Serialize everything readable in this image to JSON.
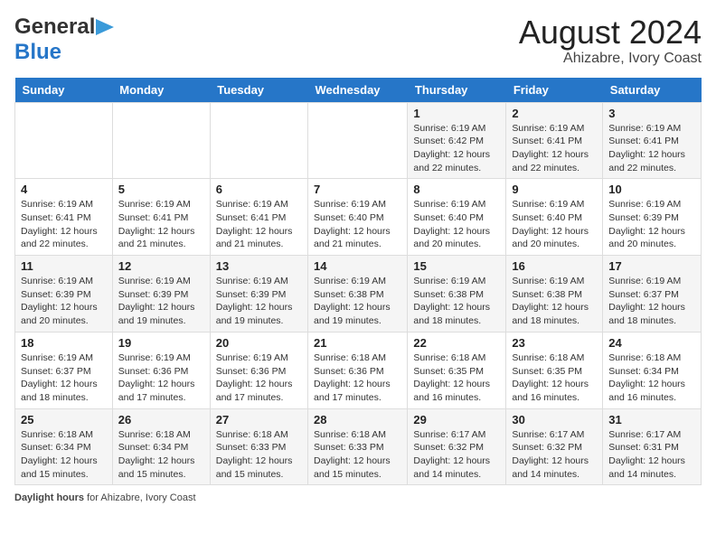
{
  "logo": {
    "line1": "General",
    "line2": "Blue"
  },
  "title": {
    "month_year": "August 2024",
    "location": "Ahizabre, Ivory Coast"
  },
  "days_of_week": [
    "Sunday",
    "Monday",
    "Tuesday",
    "Wednesday",
    "Thursday",
    "Friday",
    "Saturday"
  ],
  "weeks": [
    [
      {
        "day": "",
        "detail": ""
      },
      {
        "day": "",
        "detail": ""
      },
      {
        "day": "",
        "detail": ""
      },
      {
        "day": "",
        "detail": ""
      },
      {
        "day": "1",
        "detail": "Sunrise: 6:19 AM\nSunset: 6:42 PM\nDaylight: 12 hours\nand 22 minutes."
      },
      {
        "day": "2",
        "detail": "Sunrise: 6:19 AM\nSunset: 6:41 PM\nDaylight: 12 hours\nand 22 minutes."
      },
      {
        "day": "3",
        "detail": "Sunrise: 6:19 AM\nSunset: 6:41 PM\nDaylight: 12 hours\nand 22 minutes."
      }
    ],
    [
      {
        "day": "4",
        "detail": "Sunrise: 6:19 AM\nSunset: 6:41 PM\nDaylight: 12 hours\nand 22 minutes."
      },
      {
        "day": "5",
        "detail": "Sunrise: 6:19 AM\nSunset: 6:41 PM\nDaylight: 12 hours\nand 21 minutes."
      },
      {
        "day": "6",
        "detail": "Sunrise: 6:19 AM\nSunset: 6:41 PM\nDaylight: 12 hours\nand 21 minutes."
      },
      {
        "day": "7",
        "detail": "Sunrise: 6:19 AM\nSunset: 6:40 PM\nDaylight: 12 hours\nand 21 minutes."
      },
      {
        "day": "8",
        "detail": "Sunrise: 6:19 AM\nSunset: 6:40 PM\nDaylight: 12 hours\nand 20 minutes."
      },
      {
        "day": "9",
        "detail": "Sunrise: 6:19 AM\nSunset: 6:40 PM\nDaylight: 12 hours\nand 20 minutes."
      },
      {
        "day": "10",
        "detail": "Sunrise: 6:19 AM\nSunset: 6:39 PM\nDaylight: 12 hours\nand 20 minutes."
      }
    ],
    [
      {
        "day": "11",
        "detail": "Sunrise: 6:19 AM\nSunset: 6:39 PM\nDaylight: 12 hours\nand 20 minutes."
      },
      {
        "day": "12",
        "detail": "Sunrise: 6:19 AM\nSunset: 6:39 PM\nDaylight: 12 hours\nand 19 minutes."
      },
      {
        "day": "13",
        "detail": "Sunrise: 6:19 AM\nSunset: 6:39 PM\nDaylight: 12 hours\nand 19 minutes."
      },
      {
        "day": "14",
        "detail": "Sunrise: 6:19 AM\nSunset: 6:38 PM\nDaylight: 12 hours\nand 19 minutes."
      },
      {
        "day": "15",
        "detail": "Sunrise: 6:19 AM\nSunset: 6:38 PM\nDaylight: 12 hours\nand 18 minutes."
      },
      {
        "day": "16",
        "detail": "Sunrise: 6:19 AM\nSunset: 6:38 PM\nDaylight: 12 hours\nand 18 minutes."
      },
      {
        "day": "17",
        "detail": "Sunrise: 6:19 AM\nSunset: 6:37 PM\nDaylight: 12 hours\nand 18 minutes."
      }
    ],
    [
      {
        "day": "18",
        "detail": "Sunrise: 6:19 AM\nSunset: 6:37 PM\nDaylight: 12 hours\nand 18 minutes."
      },
      {
        "day": "19",
        "detail": "Sunrise: 6:19 AM\nSunset: 6:36 PM\nDaylight: 12 hours\nand 17 minutes."
      },
      {
        "day": "20",
        "detail": "Sunrise: 6:19 AM\nSunset: 6:36 PM\nDaylight: 12 hours\nand 17 minutes."
      },
      {
        "day": "21",
        "detail": "Sunrise: 6:18 AM\nSunset: 6:36 PM\nDaylight: 12 hours\nand 17 minutes."
      },
      {
        "day": "22",
        "detail": "Sunrise: 6:18 AM\nSunset: 6:35 PM\nDaylight: 12 hours\nand 16 minutes."
      },
      {
        "day": "23",
        "detail": "Sunrise: 6:18 AM\nSunset: 6:35 PM\nDaylight: 12 hours\nand 16 minutes."
      },
      {
        "day": "24",
        "detail": "Sunrise: 6:18 AM\nSunset: 6:34 PM\nDaylight: 12 hours\nand 16 minutes."
      }
    ],
    [
      {
        "day": "25",
        "detail": "Sunrise: 6:18 AM\nSunset: 6:34 PM\nDaylight: 12 hours\nand 15 minutes."
      },
      {
        "day": "26",
        "detail": "Sunrise: 6:18 AM\nSunset: 6:34 PM\nDaylight: 12 hours\nand 15 minutes."
      },
      {
        "day": "27",
        "detail": "Sunrise: 6:18 AM\nSunset: 6:33 PM\nDaylight: 12 hours\nand 15 minutes."
      },
      {
        "day": "28",
        "detail": "Sunrise: 6:18 AM\nSunset: 6:33 PM\nDaylight: 12 hours\nand 15 minutes."
      },
      {
        "day": "29",
        "detail": "Sunrise: 6:17 AM\nSunset: 6:32 PM\nDaylight: 12 hours\nand 14 minutes."
      },
      {
        "day": "30",
        "detail": "Sunrise: 6:17 AM\nSunset: 6:32 PM\nDaylight: 12 hours\nand 14 minutes."
      },
      {
        "day": "31",
        "detail": "Sunrise: 6:17 AM\nSunset: 6:31 PM\nDaylight: 12 hours\nand 14 minutes."
      }
    ]
  ],
  "footer": {
    "label": "Daylight hours",
    "text": " for Ahizabre, Ivory Coast"
  }
}
